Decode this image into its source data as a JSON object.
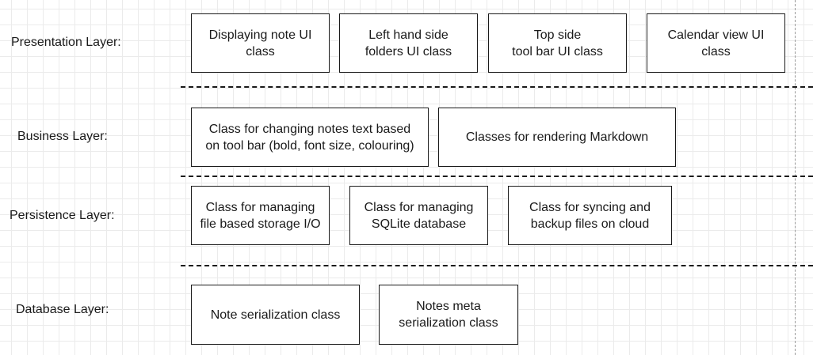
{
  "layers": [
    {
      "label": "Presentation Layer:",
      "classes": [
        "Displaying note UI\nclass",
        "Left hand side\nfolders UI class",
        "Top side\ntool bar UI class",
        "Calendar view UI\nclass"
      ]
    },
    {
      "label": "Business Layer:",
      "classes": [
        "Class for changing notes text based\non tool bar (bold, font size, colouring)",
        "Classes for rendering Markdown"
      ]
    },
    {
      "label": "Persistence Layer:",
      "classes": [
        "Class for managing\nfile based storage I/O",
        "Class for managing\nSQLite database",
        "Class for syncing and\nbackup files on cloud"
      ]
    },
    {
      "label": "Database Layer:",
      "classes": [
        "Note serialization class",
        "Notes meta\nserialization class"
      ]
    }
  ]
}
